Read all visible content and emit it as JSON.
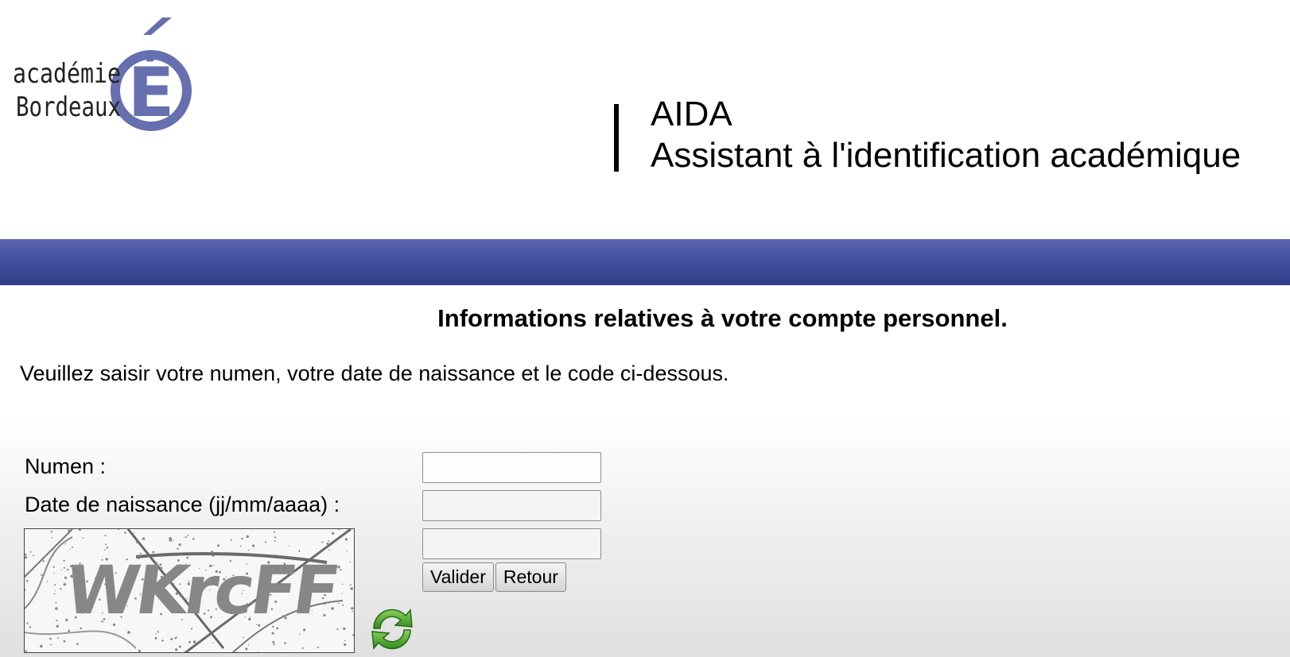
{
  "header": {
    "logo": {
      "line1": "académie",
      "line2": "Bordeaux",
      "letter": "É"
    },
    "app_name": "AIDA",
    "app_subtitle": "Assistant à l'identification académique"
  },
  "colors": {
    "band": "#3f4b9a",
    "logo_accent": "#6670b0"
  },
  "form": {
    "heading": "Informations relatives à votre compte personnel.",
    "instruction": "Veuillez saisir votre numen, votre date de naissance et le code ci-dessous.",
    "numen_label": "Numen :",
    "numen_value": "",
    "birthdate_label": "Date de naissance (jj/mm/aaaa) :",
    "birthdate_value": "",
    "captcha_value": "",
    "captcha_text": "WKrcFF",
    "validate_label": "Valider",
    "back_label": "Retour",
    "refresh_icon": "refresh-icon"
  }
}
